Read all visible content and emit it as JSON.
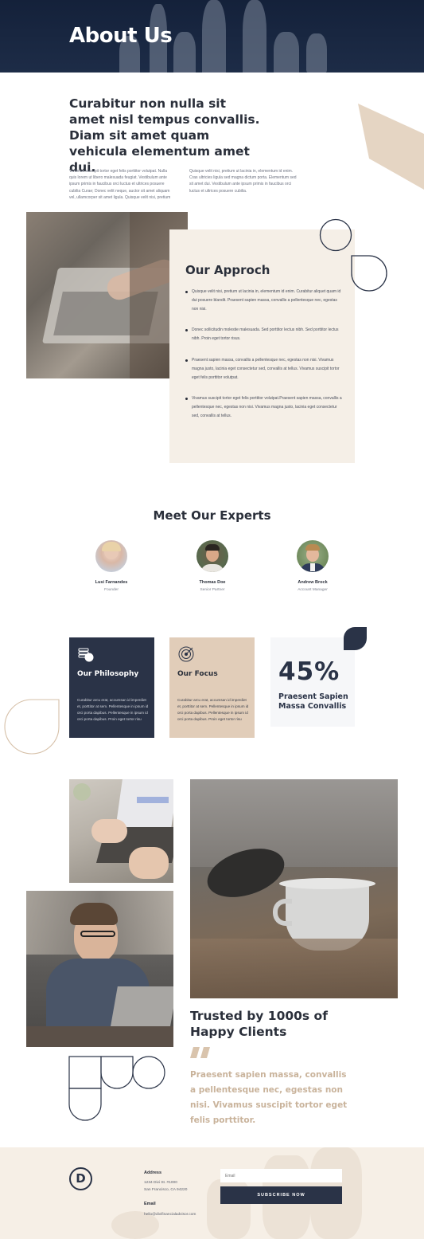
{
  "hero": {
    "title": "About Us"
  },
  "intro": {
    "heading": "Curabitur non nulla sit amet nisl tempus convallis. Diam sit amet quam vehicula elementum amet dui.",
    "col1": "Vivamus suscipit tortor eget felis porttitor volutpat. Nulla quis lorem ut libero malesuada feugiat. Vestibulum ante ipsum primis in faucibus orci luctus et ultrices posuere cubilia Curae; Donec velit neque, auctor sit amet aliquam vel, ullamcorper sit amet ligula. Quisque velit nisi, pretium",
    "col2": "Quisque velit nisi, pretium ut lacinia in, elementum id enim. Cras ultricies ligula sed magna dictum porta. Elementum sed sit amet dui. Vestibulum ante ipsum primis in faucibus orci luctus et ultrices posuere cubilia."
  },
  "approach": {
    "title": "Our Approch",
    "items": [
      "Quisque velit nisi, pretium ut lacinia in, elementum id enim. Curabitur aliquet quam id dui posuere blandit. Praesent sapien massa, convallis a pellentesque nec, egestas non nisi.",
      "Donec sollicitudin molestie malesuada. Sed porttitor lectus nibh. Sed porttitor lectus nibh. Proin eget tortor risus.",
      "Praesent sapien massa, convallis a pellentesque nec, egestas non nisi. Vivamus magna justo, lacinia eget consectetur sed, convallis at tellus. Vivamus suscipit tortor eget felis porttitor volutpat.",
      "Vivamus suscipit tortor eget felis porttitor volutpat.Praesent sapien massa, convallis a pellentesque nec, egestas non nisi. Vivamus magna justo, lacinia eget consectetur sed, convallis at tellus."
    ]
  },
  "experts": {
    "title": "Meet Our Experts",
    "people": [
      {
        "name": "Lusi Farnandes",
        "role": "Founder"
      },
      {
        "name": "Thomas Doe",
        "role": "Senior Partner"
      },
      {
        "name": "Andrew Brock",
        "role": "Account Manager"
      }
    ]
  },
  "cards": {
    "philosophy": {
      "title": "Our Philosophy",
      "body": "Curabitur arcu erat, accumsan id imperdiet et, porttitor at sem. Pellentesque in ipsum id orci porta dapibus. Pellentesque in ipsum id orci porta dapibus. Proin eget tortor risu"
    },
    "focus": {
      "title": "Our Focus",
      "body": "Curabitur arcu erat, accumsan id imperdiet et, porttitor at sem. Pellentesque in ipsum id orci porta dapibus. Pellentesque in ipsum id orci porta dapibus. Proin eget tortor risu"
    },
    "stat": {
      "number": "45%",
      "label": "Praesent Sapien Massa Convallis"
    }
  },
  "testimonial": {
    "title": "Trusted by 1000s of Happy Clients",
    "quote": "Praesent sapien massa, convallis a pellentesque nec, egestas non nisi. Vivamus suscipit tortor eget felis porttitor."
  },
  "footer": {
    "logo_letter": "D",
    "address_label": "Address",
    "address_line1": "1234 Divi St. #1000",
    "address_line2": "San Francisco, CA 94220",
    "email_label": "Email",
    "email_value": "hello@divifinancialadvisor.com",
    "email_placeholder": "Email",
    "subscribe_label": "SUBSCRIBE NOW"
  },
  "colors": {
    "navy": "#2a3347",
    "tan": "#e1cdb9",
    "cream": "#f5efe7",
    "quote": "#c9b39b"
  }
}
